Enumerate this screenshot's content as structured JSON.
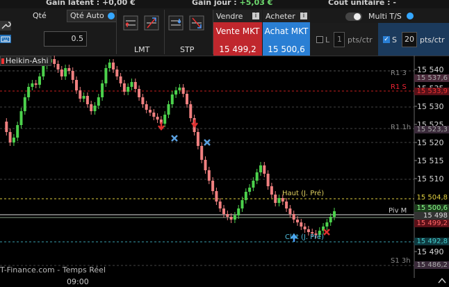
{
  "status": {
    "latent": "Gain latent : +0,00 €",
    "jour_prefix": "Gain jour :",
    "jour_value": "+5,03 €",
    "cout": "Coût unitaire : -"
  },
  "toolbar": {
    "qty_label": "Qté",
    "qty_auto": "Qté Auto",
    "qty_value": "0.5",
    "lmt": "LMT",
    "stp": "STP",
    "vendre": "Vendre",
    "acheter": "Acheter",
    "sell_label": "Vente MKT",
    "sell_price": "15 499,2",
    "buy_label": "Achat MKT",
    "buy_price": "15 500,6",
    "multi": "Multi T/S",
    "l_label": "L",
    "l_value": "1",
    "l_unit": "pts/ctr",
    "s_label": "S",
    "s_value": "20",
    "s_unit": "pts/ctr"
  },
  "chart": {
    "style_label": "Heikin-Ashi",
    "watermark": "T-Finance.com - Temps Réel",
    "time_label": "09:00",
    "levels": {
      "r1_3": "R1 3",
      "r1_s": "R1 S",
      "r1_1": "R1 1h",
      "piv_m": "Piv M",
      "s1_3": "S1 3h",
      "haut": "Haut (J. Pré)",
      "clot": "Clôt (J. Pré)"
    },
    "price_ticks": [
      "15 540",
      "15 535",
      "15 530",
      "15 525",
      "15 520",
      "15 515",
      "15 510",
      "15 505",
      "15 495",
      "15 490"
    ],
    "price_tags": {
      "t1": "15 537,6",
      "t2": "15 533,9",
      "t3": "15 523,3",
      "t4": "15 504,8",
      "t5": "15 500,6",
      "t6": "15 499,2",
      "t7": "15 492,8",
      "t8": "15 486,2",
      "t9": "15 498"
    }
  },
  "colors": {
    "up": "#4cd24c",
    "down": "#f08080",
    "sell": "#c0272d",
    "buy": "#2a7fd4"
  }
}
